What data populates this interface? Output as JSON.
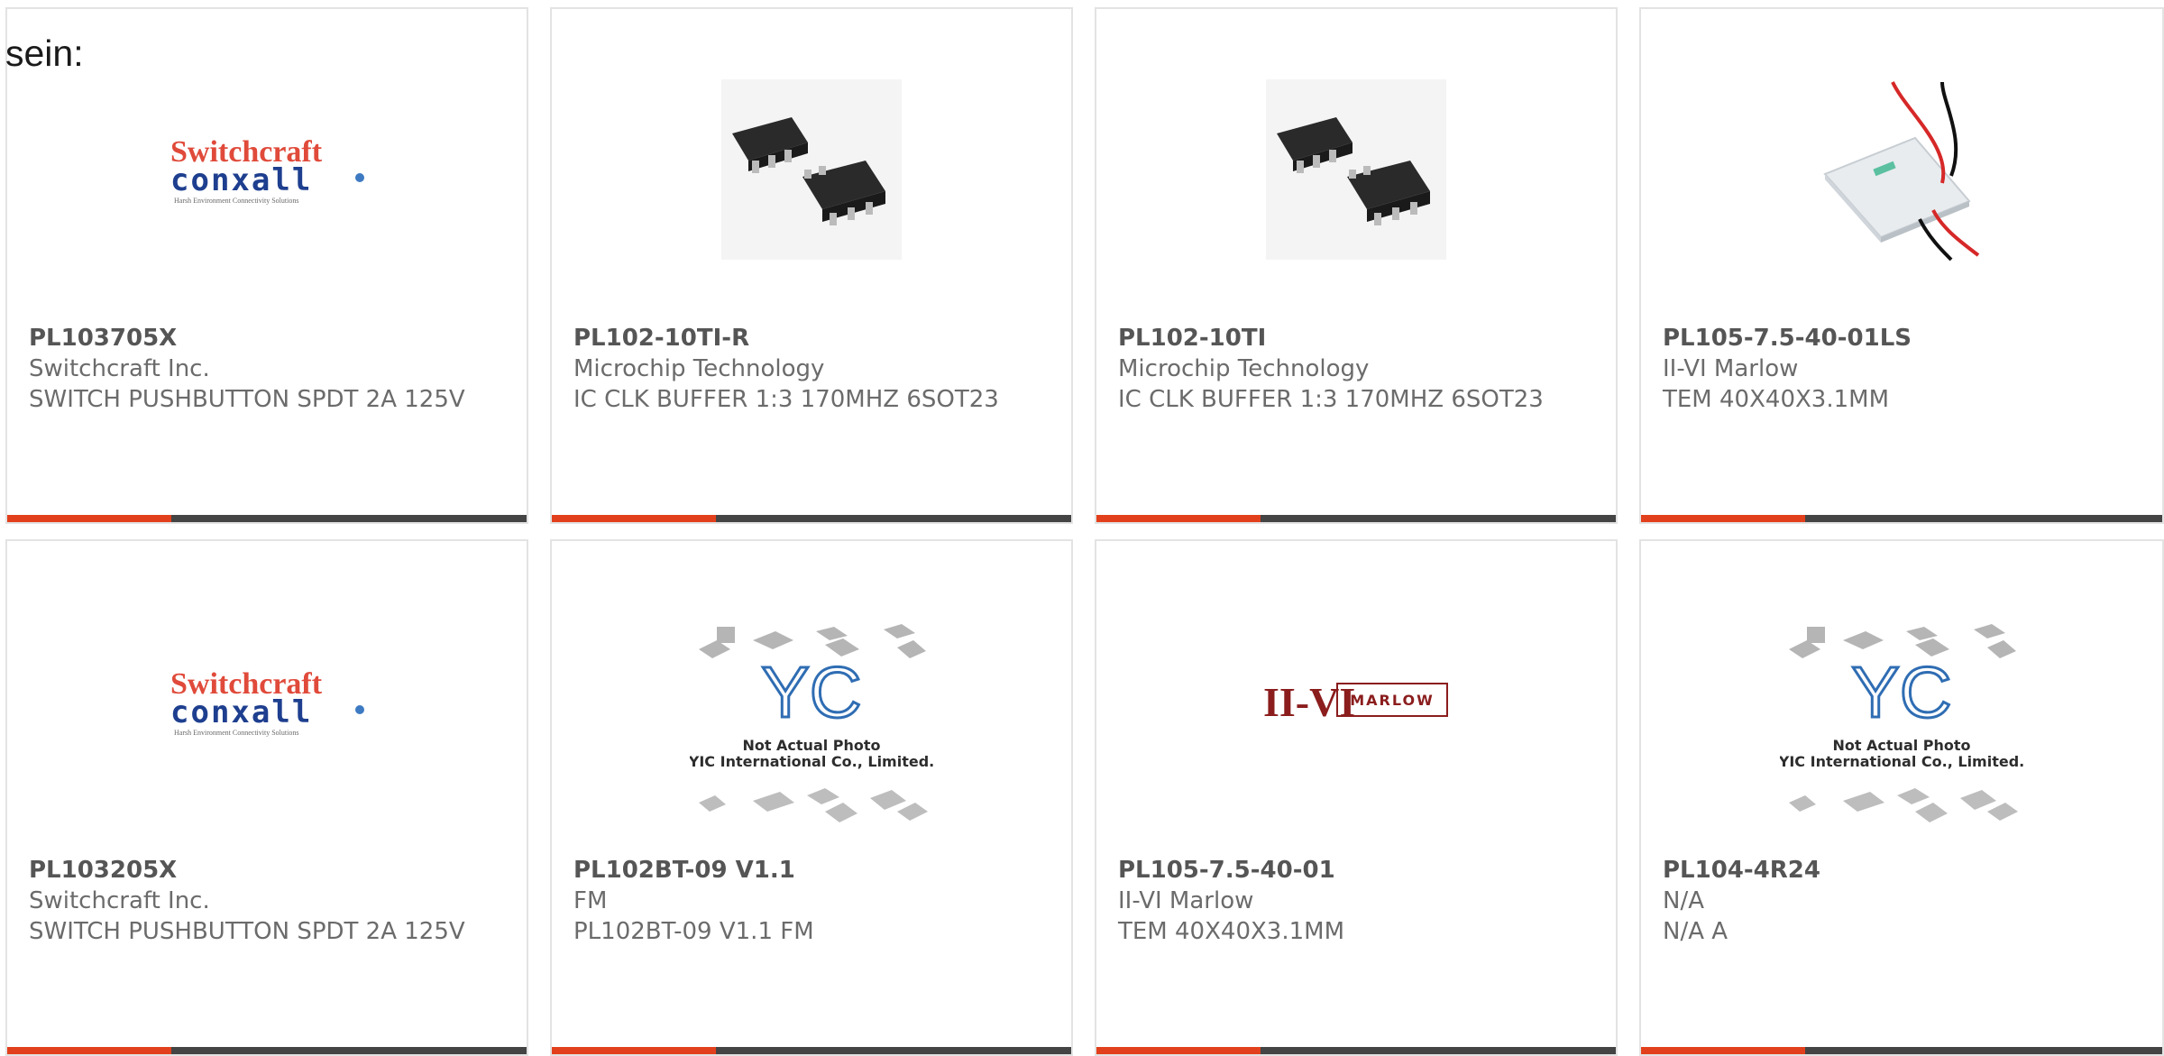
{
  "intro_text": "sein:",
  "colors": {
    "accent": "#e2401c",
    "bar": "#444444",
    "part_number": "#555555",
    "body_text": "#6b6b6b",
    "card_border": "#e3e3e3"
  },
  "products": [
    {
      "part": "PL103705X",
      "maker": "Switchcraft Inc.",
      "desc": "SWITCH PUSHBUTTON SPDT 2A 125V",
      "image": "switchcraft-conxall-logo",
      "logo_line1": "Switchcraft",
      "logo_line2": "conxall",
      "logo_tag": "Harsh Environment Connectivity Solutions"
    },
    {
      "part": "PL102-10TI-R",
      "maker": "Microchip Technology",
      "desc": "IC CLK BUFFER 1:3 170MHZ 6SOT23",
      "image": "sot23-chip-photo"
    },
    {
      "part": "PL102-10TI",
      "maker": "Microchip Technology",
      "desc": "IC CLK BUFFER 1:3 170MHZ 6SOT23",
      "image": "sot23-chip-photo"
    },
    {
      "part": "PL105-7.5-40-01LS",
      "maker": "II-VI Marlow",
      "desc": "TEM 40X40X3.1MM",
      "image": "thermoelectric-module-photo"
    },
    {
      "part": "PL103205X",
      "maker": "Switchcraft Inc.",
      "desc": "SWITCH PUSHBUTTON SPDT 2A 125V",
      "image": "switchcraft-conxall-logo",
      "logo_line1": "Switchcraft",
      "logo_line2": "conxall",
      "logo_tag": "Harsh Environment Connectivity Solutions"
    },
    {
      "part": "PL102BT-09 V1.1",
      "maker": "FM",
      "desc": "PL102BT-09 V1.1 FM",
      "image": "yic-placeholder",
      "ph_line1": "Not Actual Photo",
      "ph_line2": "YIC International Co., Limited."
    },
    {
      "part": "PL105-7.5-40-01",
      "maker": "II-VI Marlow",
      "desc": "TEM 40X40X3.1MM",
      "image": "ii-vi-marlow-logo",
      "logo_line1": "II-VI",
      "logo_line2": "MARLOW"
    },
    {
      "part": "PL104-4R24",
      "maker": "N/A",
      "desc": "N/A A",
      "image": "yic-placeholder",
      "ph_line1": "Not Actual Photo",
      "ph_line2": "YIC International Co., Limited."
    }
  ]
}
